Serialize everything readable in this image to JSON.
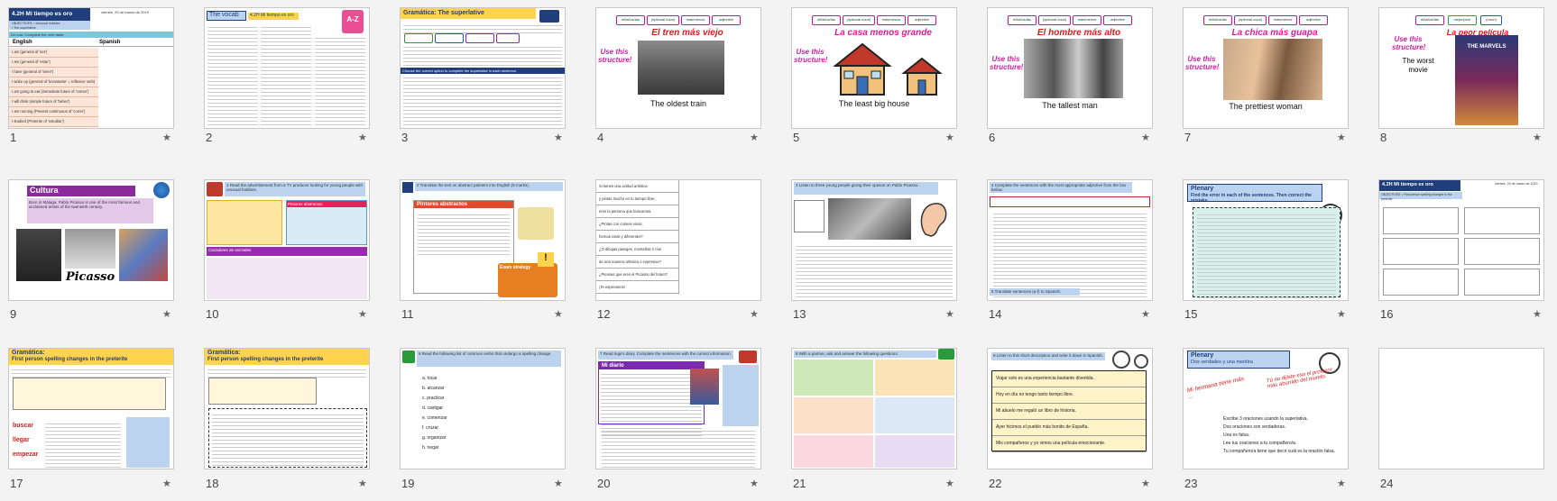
{
  "slides": [
    {
      "n": "1",
      "title": "4.2H Mi tiempo es oro",
      "date": "viernes, 29 de marzo de 2019",
      "objectives": "OBJECTIVES: • Unusual hobbies\n• The superlative",
      "do_now": "Do now: Complete the verb table.",
      "col1": "English",
      "col2": "Spanish",
      "rows": [
        "I am (general of 'ser')",
        "I am (general of 'estar')",
        "I have (general of 'tener')",
        "I woke up (general of 'levantarse' = reflexive verb)",
        "I am going to eat (immediate future of 'comer')",
        "I will drink (simple future of 'beber')",
        "I am running (Present continuous of 'correr')",
        "I studied (Preterite of 'estudiar')"
      ]
    },
    {
      "n": "2",
      "title": "The vocab",
      "subtitle": "4.2H Mi tiempo es oro"
    },
    {
      "n": "3",
      "title": "Gramática: The superlative",
      "note": "Choose the correct option to complete the superlative in each sentence."
    },
    {
      "n": "4",
      "pill1": "el/la/los/las",
      "pill2": "(optional noun)",
      "pill3": "más/menos",
      "pill4": "adjective",
      "use": "Use this structure!",
      "heading": "El tren más viejo",
      "caption": "The oldest train"
    },
    {
      "n": "5",
      "pill1": "el/la/los/las",
      "pill2": "(optional noun)",
      "pill3": "más/menos",
      "pill4": "adjective",
      "use": "Use this structure!",
      "heading": "La casa menos grande",
      "caption": "The least big house"
    },
    {
      "n": "6",
      "pill1": "el/la/los/las",
      "pill2": "(optional noun)",
      "pill3": "más/menos",
      "pill4": "adjective",
      "use": "Use this structure!",
      "heading": "El hombre más alto",
      "caption": "The tallest man"
    },
    {
      "n": "7",
      "pill1": "el/la/los/las",
      "pill2": "(optional noun)",
      "pill3": "más/menos",
      "pill4": "adjective",
      "use": "Use this structure!",
      "heading": "La chica más guapa",
      "caption": "The prettiest woman"
    },
    {
      "n": "8",
      "pill1": "el/la/los/las",
      "pill2": "mejor/peor",
      "pill3": "(noun)",
      "use": "Use this structure!",
      "heading": "La peor película",
      "caption": "The worst movie",
      "poster": "THE MARVELS"
    },
    {
      "n": "9",
      "title": "Cultura",
      "text": "Born in Málaga, Pablo Picasso is one of the most famous and acclaimed artists of the twentieth century.",
      "signature": "Picasso"
    },
    {
      "n": "10",
      "task": "1 Read the advertisement from a TV producer looking for young people with unusual hobbies.",
      "box1": "Cazadores de animales",
      "box2": "Pintores abstractos"
    },
    {
      "n": "11",
      "task": "2 Translate the text on abstract painters into English (9 marks).",
      "heading": "Pintores abstractos",
      "tip": "Exam strategy"
    },
    {
      "n": "12",
      "rows": [
        "Si tienes una actitud artística",
        "y pintas mucho en tu tiempo libre,",
        "eres la persona que buscamos.",
        "¿Pintas con colores vivos,",
        "formas raras y diferentes?",
        "¿O dibujas paisajes, montañas o ríos",
        "de una manera artística o expresiva?",
        "¿Piensas que eres el Picasso del futuro?",
        "¡Te esperamos!"
      ]
    },
    {
      "n": "13",
      "task": "3 Listen to three young people giving their opinion on Pablo Picasso."
    },
    {
      "n": "14",
      "task": "4 Complete the sentences with the most appropriate adjective from the box below.",
      "task2": "5 Translate sentences (a-f) to Spanish."
    },
    {
      "n": "15",
      "title": "Plenary",
      "subtitle": "Find the error in each of the sentences. Then correct the mistake"
    },
    {
      "n": "16",
      "title": "4.2H Mi tiempo es oro",
      "date": "viernes, 29 de marzo de 2019",
      "objectives": "OBJECTIVES: • First person spelling changes in the preterite"
    },
    {
      "n": "17",
      "title": "Gramática:",
      "subtitle": "First person spelling changes in the preterite",
      "w1": "buscar",
      "w2": "llegar",
      "w3": "empezar"
    },
    {
      "n": "18",
      "title": "Gramática:",
      "subtitle": "First person spelling changes in the preterite"
    },
    {
      "n": "19",
      "task": "6 Read the following list of common verbs that undergo a spelling change.",
      "verbs": [
        "a. tocar",
        "b. alcanzar",
        "c. practicar",
        "d. castigar",
        "e. comenzar",
        "f. cruzar",
        "g. organizar",
        "h. negar"
      ]
    },
    {
      "n": "20",
      "task": "7 Read Inge's diary. Complete the sentences with the correct information.",
      "heading": "Mi diario"
    },
    {
      "n": "21",
      "task": "8 With a partner, ask and answer the following questions:"
    },
    {
      "n": "22",
      "task": "9 Listen to this short description and write it down in Spanish.",
      "rows": [
        "Viajar solo es una experiencia bastante divertida.",
        "Hoy en día no tengo tanto tiempo libre.",
        "Mi abuelo me regaló un libro de historia.",
        "Ayer hicimos el pueblo más bonito de España.",
        "Mis compañeros y yo vimos una película emocionante."
      ]
    },
    {
      "n": "23",
      "title": "Plenary",
      "subtitle": "Dos verdades y una mentira",
      "note1": "Mi hermana tiene más ...",
      "note2": "Tú no dijiste eso el profesor más aburrido del mundo.",
      "lines": [
        "Escribe 3 oraciones usando la superlativa.",
        "Dos oraciones son verdaderas.",
        "Una es falsa.",
        "Lee tus oraciones a tu compañero/a.",
        "Tu compañero/a tiene que decir cuál es la oración falsa."
      ]
    },
    {
      "n": "24"
    }
  ],
  "star_glyph": "★",
  "colors": {
    "accent_pink": "#d21f9c",
    "header_blue": "#1f3e7a",
    "grammar_yellow": "#ffd34d",
    "panel_blue": "#bcd3f0",
    "red": "#d21f1f"
  }
}
